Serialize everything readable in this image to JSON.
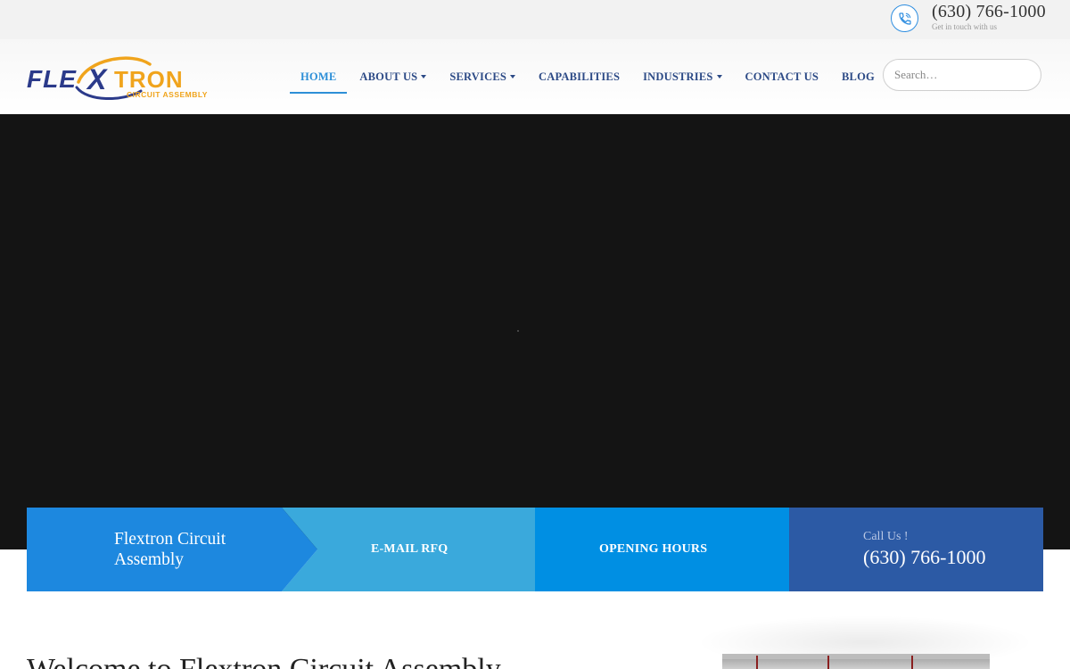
{
  "topbar": {
    "phone": "(630) 766-1000",
    "subtitle": "Get in touch with us",
    "icon": "phone-icon"
  },
  "logo": {
    "wordmark": "FLEXTRON",
    "tagline": "CIRCUIT ASSEMBLY",
    "colors": {
      "primary": "#2b3a8a",
      "accent": "#f0a41c"
    }
  },
  "nav": {
    "items": [
      {
        "label": "HOME",
        "active": true,
        "dropdown": false
      },
      {
        "label": "ABOUT US",
        "active": false,
        "dropdown": true
      },
      {
        "label": "SERVICES",
        "active": false,
        "dropdown": true
      },
      {
        "label": "CAPABILITIES",
        "active": false,
        "dropdown": false
      },
      {
        "label": "INDUSTRIES",
        "active": false,
        "dropdown": true
      },
      {
        "label": "CONTACT US",
        "active": false,
        "dropdown": false
      },
      {
        "label": "BLOG",
        "active": false,
        "dropdown": false
      }
    ]
  },
  "search": {
    "placeholder": "Search…"
  },
  "info_boxes": {
    "company": "Flextron Circuit Assembly",
    "email_rfq": "E-MAIL RFQ",
    "opening_hours": "OPENING HOURS",
    "call_label": "Call Us !",
    "call_number": "(630) 766-1000"
  },
  "main": {
    "welcome_title": "Welcome to Flextron Circuit Assembly"
  },
  "colors": {
    "nav_text": "#2c4a86",
    "active": "#2d8fd7",
    "box1": "#1d88df",
    "box2": "#3aa9dc",
    "box3": "#008fe3",
    "box4": "#2c5aa5",
    "hero": "#141414"
  }
}
